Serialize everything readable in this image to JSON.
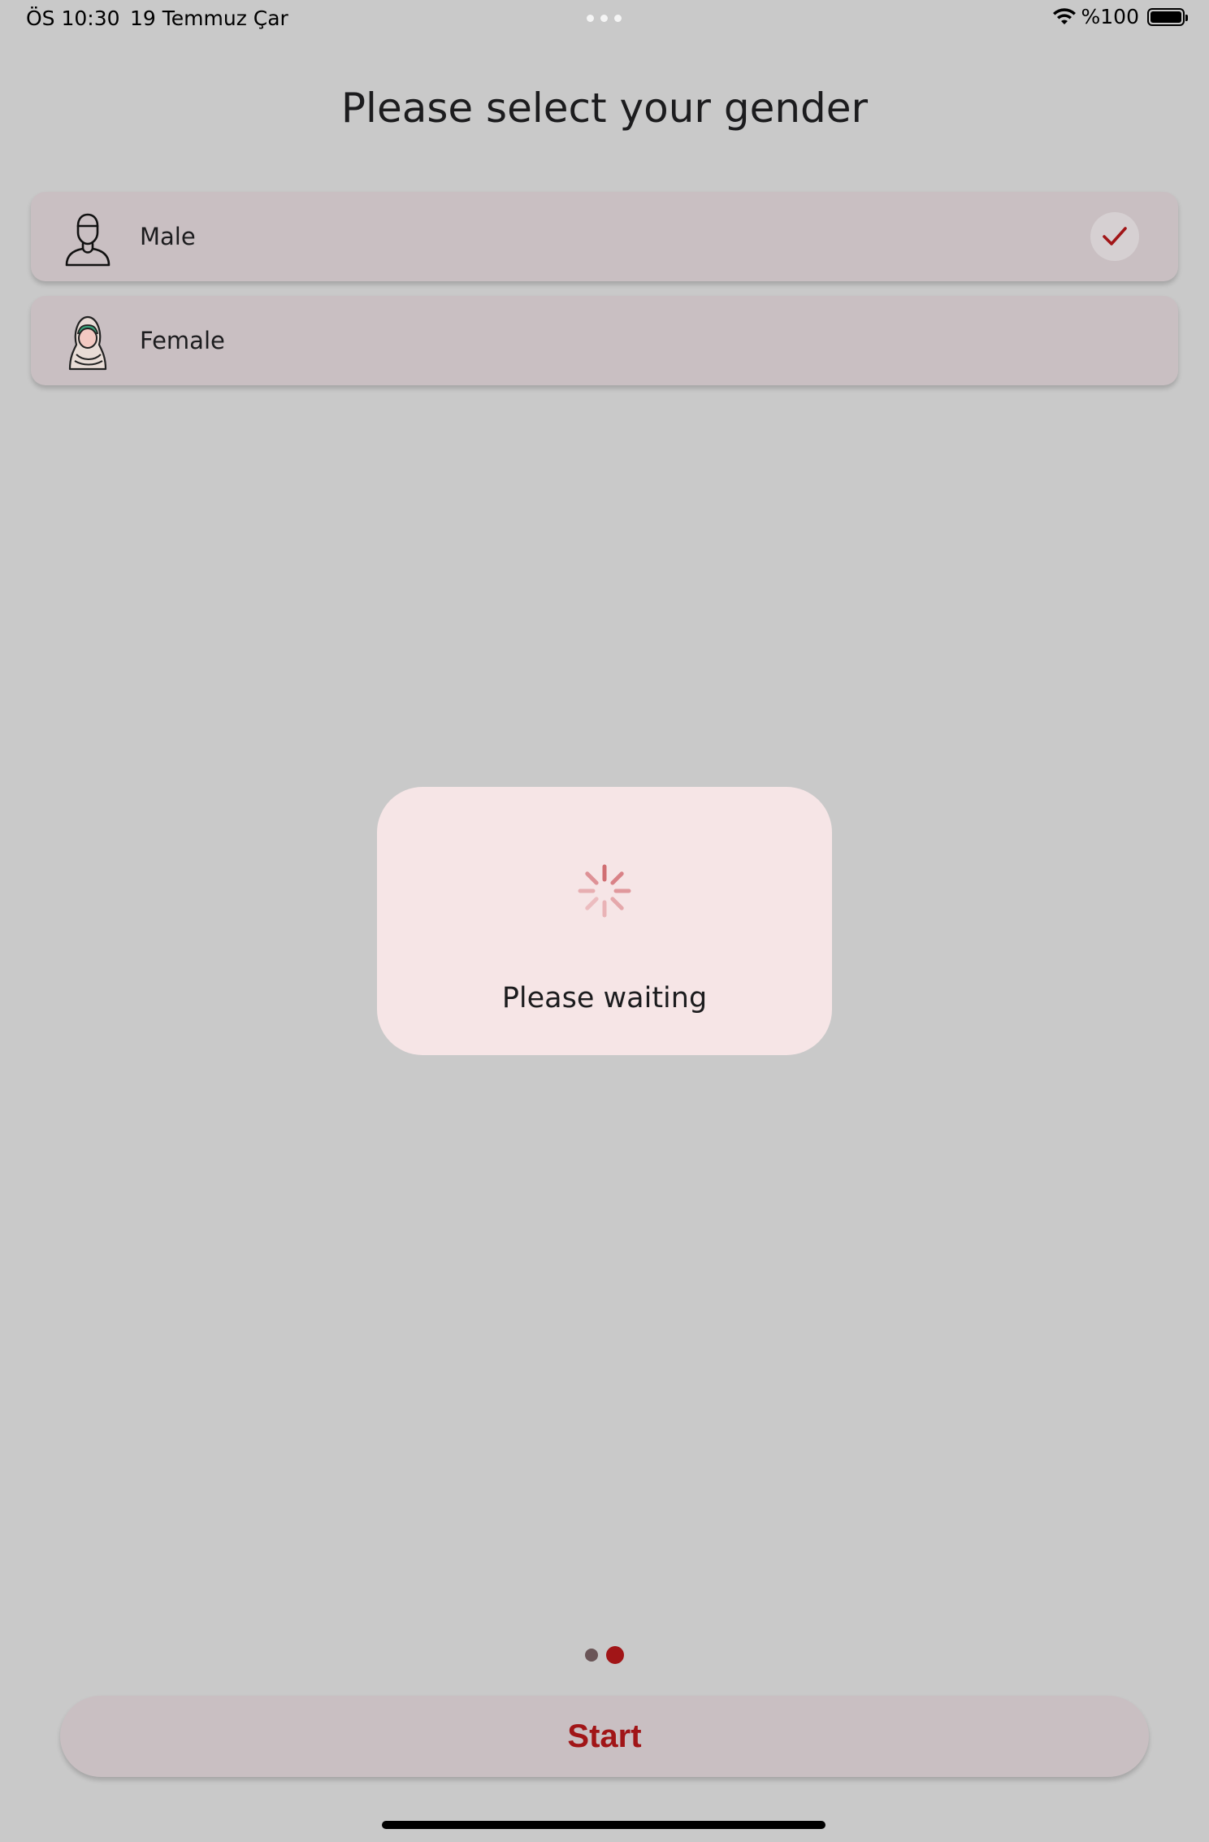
{
  "status_bar": {
    "time": "ÖS 10:30",
    "date": "19 Temmuz Çar",
    "battery_percent": "%100",
    "icons": [
      "wifi-icon",
      "battery-icon"
    ]
  },
  "page": {
    "title": "Please select your gender"
  },
  "options": [
    {
      "label": "Male",
      "icon": "male-avatar-icon",
      "selected": true
    },
    {
      "label": "Female",
      "icon": "female-avatar-icon",
      "selected": false
    }
  ],
  "dialog": {
    "message": "Please waiting",
    "icon": "loading-spinner-icon"
  },
  "pager": {
    "total": 2,
    "current": 2
  },
  "footer": {
    "start_label": "Start"
  },
  "colors": {
    "background": "#c9c9c9",
    "card": "#c9bfc2",
    "accent": "#a11517",
    "dialog": "#f6e5e6"
  }
}
